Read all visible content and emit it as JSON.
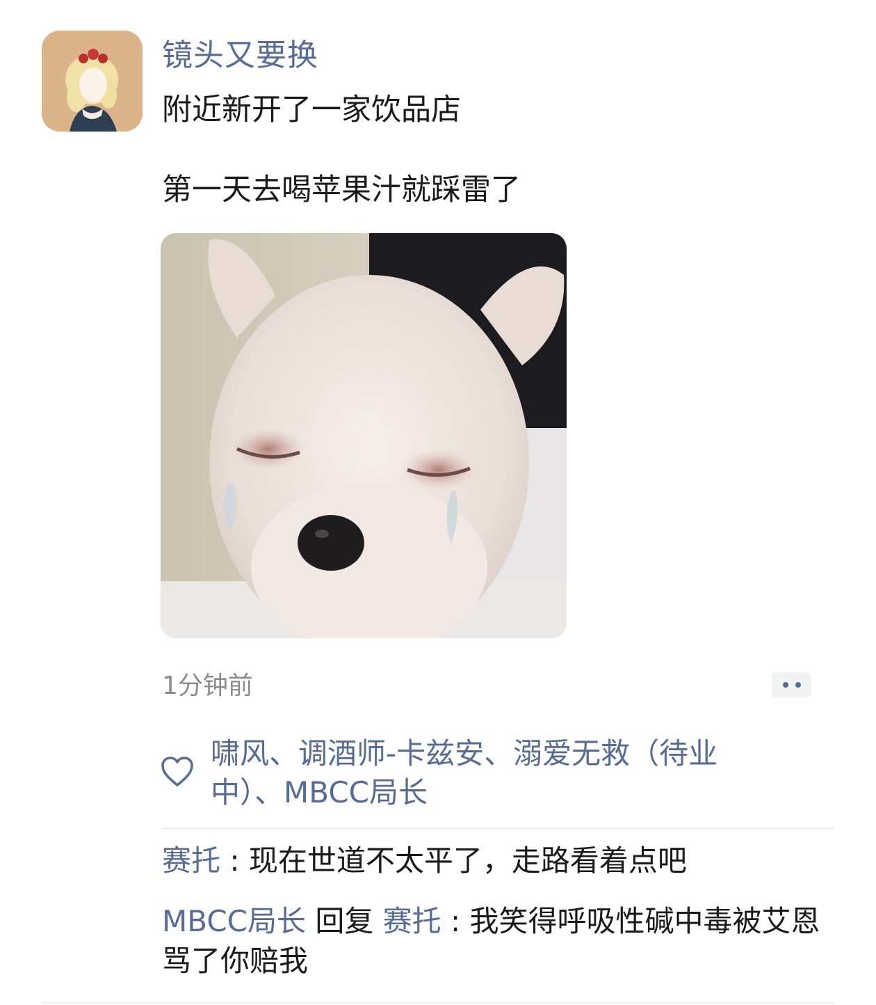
{
  "post": {
    "author": "镜头又要换",
    "text_line1": "附近新开了一家饮品店",
    "text_line2": "第一天去喝苹果汁就踩雷了",
    "image_alt": "crying-puppy-meme",
    "timestamp": "1分钟前"
  },
  "likes": {
    "names_text": "啸风、调酒师-卡兹安、溺爱无救（待业中）、MBCC局长"
  },
  "comments": [
    {
      "author": "赛托",
      "separator": " : ",
      "text": "现在世道不太平了，走路看着点吧"
    },
    {
      "author": "MBCC局长",
      "reply_word": " 回复 ",
      "reply_to": "赛托",
      "separator": " : ",
      "text": "我笑得呼吸性碱中毒被艾恩骂了你赔我"
    }
  ],
  "colors": {
    "name_link": "#576b95",
    "text": "#1a1a1a",
    "timestamp": "#8c8c8c",
    "more_button_bg": "#f2f3f5"
  },
  "icons": {
    "like": "heart-outline-icon",
    "more": "more-dots-icon"
  }
}
